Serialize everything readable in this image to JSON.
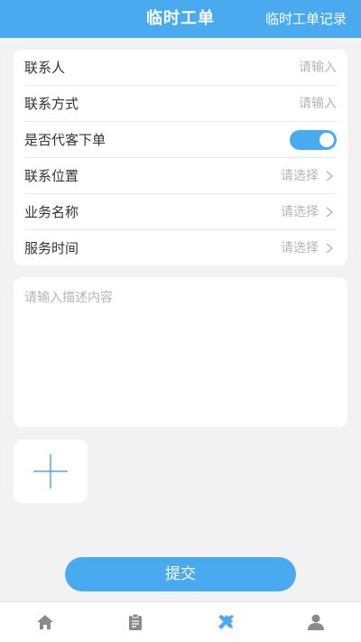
{
  "header": {
    "title": "临时工单",
    "records_link": "临时工单记录"
  },
  "form": {
    "rows": [
      {
        "label": "联系人",
        "placeholder": "请输入",
        "type": "input"
      },
      {
        "label": "联系方式",
        "placeholder": "请输入",
        "type": "input"
      },
      {
        "label": "是否代客下单",
        "type": "toggle",
        "toggle_on": true
      },
      {
        "label": "联系位置",
        "placeholder": "请选择",
        "type": "select"
      },
      {
        "label": "业务名称",
        "placeholder": "请选择",
        "type": "select"
      },
      {
        "label": "服务时间",
        "placeholder": "请选择",
        "type": "select"
      }
    ]
  },
  "description": {
    "placeholder": "请输入描述内容"
  },
  "add_photo": {
    "icon": "plus-icon"
  },
  "submit": {
    "label": "提交"
  },
  "tabbar": {
    "active_index": 2,
    "tabs": [
      {
        "icon": "home-icon"
      },
      {
        "icon": "clipboard-icon"
      },
      {
        "icon": "tools-icon"
      },
      {
        "icon": "user-icon"
      }
    ]
  },
  "colors": {
    "accent": "#4aaaf0",
    "inactive_icon": "#8a8a8a",
    "placeholder": "#b5b5b5",
    "background": "#f2f2f2"
  }
}
